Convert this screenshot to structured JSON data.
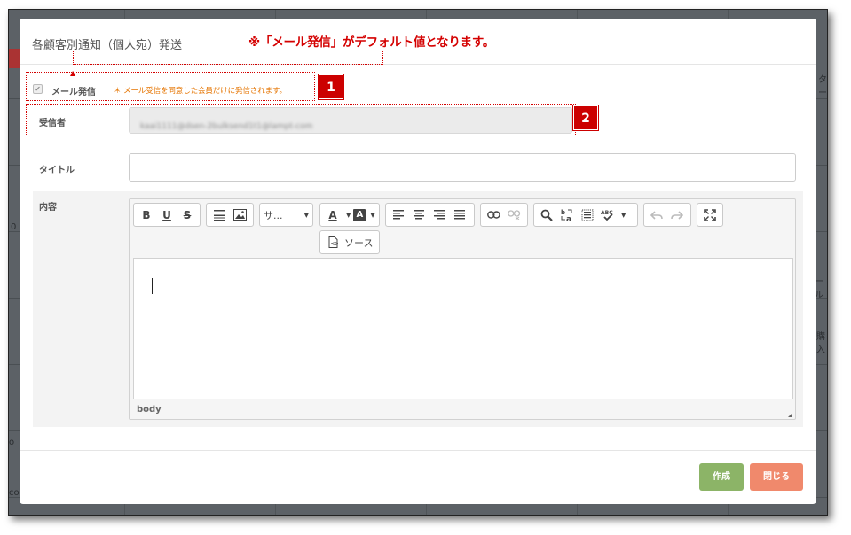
{
  "background": {
    "fragments": [
      "ー",
      "ール",
      "購入",
      "o",
      "co",
      "0",
      "ター"
    ]
  },
  "modal": {
    "title": "各顧客別通知（個人宛）発送",
    "annotation": "※「メール発信」がデフォルト値となります。",
    "badges": [
      "1",
      "2"
    ],
    "mail": {
      "check_mark": "✔",
      "label": "メール発信",
      "note": "＊ メール受信を同意した会員だけに発信されます。"
    },
    "sender": {
      "label": "受信者",
      "value": "kaai1111@dsen-2bulksend1t1@lampt-com"
    },
    "title_field": {
      "label": "タイトル",
      "value": ""
    },
    "content": {
      "label": "内容",
      "toolbar": {
        "bold": "B",
        "underline": "U",
        "strike": "S",
        "size_dropdown": "サ...",
        "text_color": "A",
        "bg_color": "A",
        "source": "ソース"
      },
      "element_path": "body"
    },
    "buttons": {
      "create": "作成",
      "close": "閉じる"
    }
  },
  "colors": {
    "annotation_red": "#d40000",
    "note_orange": "#e57400",
    "create_green": "#8cb467",
    "close_salmon": "#f0896c"
  }
}
